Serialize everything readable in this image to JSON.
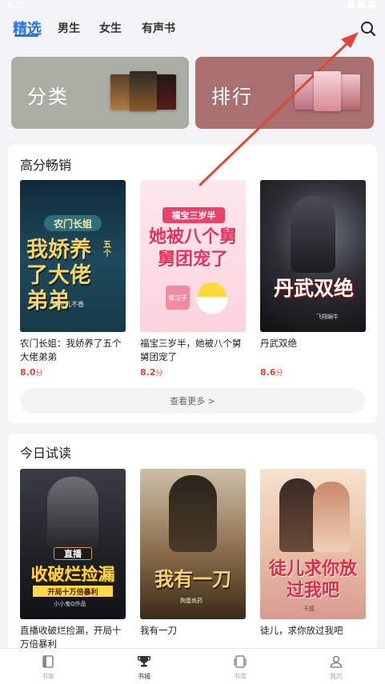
{
  "status": {
    "time": "9:23"
  },
  "tabs": [
    {
      "label": "精选",
      "active": true
    },
    {
      "label": "男生"
    },
    {
      "label": "女生"
    },
    {
      "label": "有声书"
    }
  ],
  "categories": {
    "classify": {
      "label": "分类"
    },
    "ranking": {
      "label": "排行"
    }
  },
  "high_score": {
    "title": "高分畅销",
    "more_label": "查看更多 >",
    "books": [
      {
        "title": "农门长姐：我娇养了五个大佬弟弟",
        "score": "8.0",
        "unit": "分",
        "cover_text_main": "我娇养了大佬弟弟",
        "cover_text_top": "农门长姐",
        "cover_text_side": "五个",
        "cover_author": "香奈儿不香"
      },
      {
        "title": "福宝三岁半，她被八个舅舅团宠了",
        "score": "8.2",
        "unit": "分",
        "cover_text_top": "福宝三岁半",
        "cover_text_main": "她被八个舅舅团宠了",
        "cover_author": "菊汉子"
      },
      {
        "title": "丹武双绝",
        "score": "8.6",
        "unit": "分",
        "cover_text_main": "丹武双绝",
        "cover_author": "飞翔蜗牛"
      }
    ]
  },
  "today_trial": {
    "title": "今日试读",
    "books": [
      {
        "title": "直播收破烂捡漏，开局十万倍暴利",
        "cover_text_top": "直播",
        "cover_text_main": "收破烂捡漏",
        "cover_text_sub": "开局十万倍暴利",
        "cover_author": "小小鬼Q作品"
      },
      {
        "title": "我有一刀",
        "cover_text_main": "我有一刀",
        "cover_author": "狗蛋尚药"
      },
      {
        "title": "徒儿，求你放过我吧",
        "cover_text_main": "徒儿求你放过我吧",
        "cover_author": "千狐"
      }
    ]
  },
  "bottom_nav": [
    {
      "label": "书架",
      "icon": "bookshelf-icon"
    },
    {
      "label": "书城",
      "icon": "trophy-icon",
      "active": true
    },
    {
      "label": "书库",
      "icon": "library-icon"
    },
    {
      "label": "我的",
      "icon": "profile-icon"
    }
  ],
  "colors": {
    "accent": "#2b73e0",
    "score": "#e0463a",
    "annotation_arrow": "#e0463a",
    "classify_card": "#a9ada4",
    "ranking_card": "#a8706e"
  }
}
